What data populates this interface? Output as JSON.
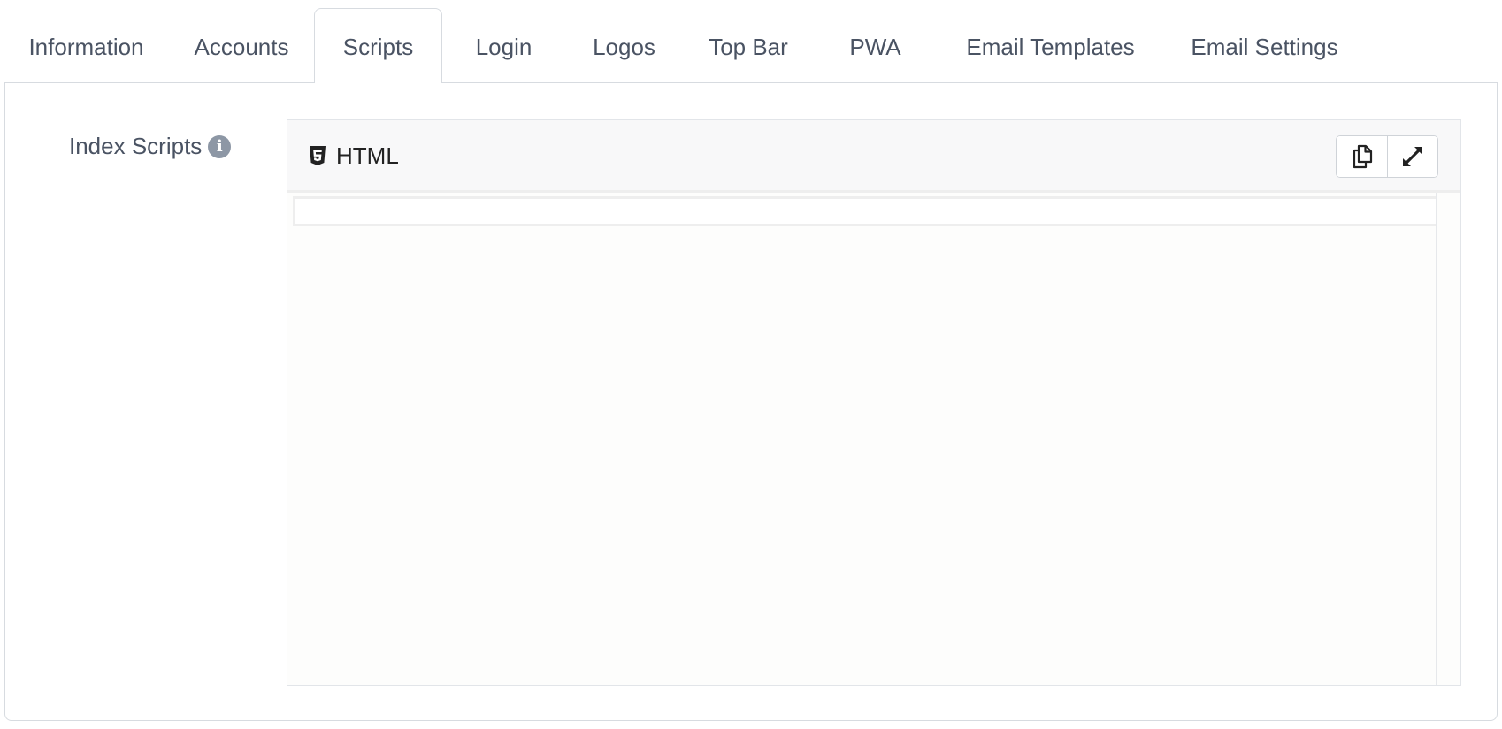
{
  "tabs": [
    {
      "label": "Information",
      "active": false
    },
    {
      "label": "Accounts",
      "active": false
    },
    {
      "label": "Scripts",
      "active": true
    },
    {
      "label": "Login",
      "active": false
    },
    {
      "label": "Logos",
      "active": false
    },
    {
      "label": "Top Bar",
      "active": false
    },
    {
      "label": "PWA",
      "active": false
    },
    {
      "label": "Email Templates",
      "active": false
    },
    {
      "label": "Email Settings",
      "active": false
    }
  ],
  "field": {
    "label": "Index Scripts",
    "info_icon": "info-circle-icon"
  },
  "editor": {
    "language": "HTML",
    "language_icon": "html5-icon",
    "copy_icon": "copy-icon",
    "expand_icon": "expand-icon",
    "content": ""
  },
  "colors": {
    "text": "#4a5363",
    "border": "#d7dbe0",
    "info_icon_bg": "#8d97a5",
    "editor_header_bg": "#f8f8f9",
    "editor_bg": "#fdfdfc"
  }
}
